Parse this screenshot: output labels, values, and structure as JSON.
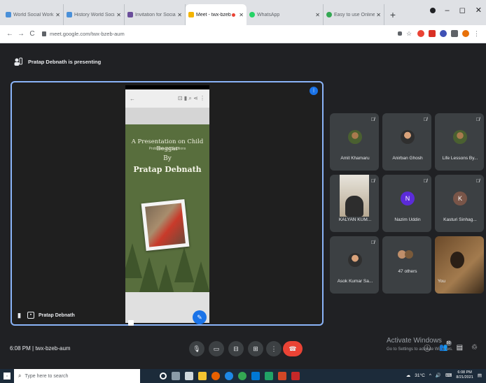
{
  "browser": {
    "tabs": [
      {
        "title": "World Social Work Da",
        "fav": "#4a90d9"
      },
      {
        "title": "History World Social",
        "fav": "#4a90d9"
      },
      {
        "title": "Invitation for Social W",
        "fav": "#6b4e9b"
      },
      {
        "title": "Meet - twx-bzeb",
        "fav": "#f4b400",
        "active": true
      },
      {
        "title": "WhatsApp",
        "fav": "#25d366"
      },
      {
        "title": "Easy to use Online PD",
        "fav": "#34a853"
      }
    ],
    "new_tab": "+",
    "url": "meet.google.com/twx-bzeb-aum",
    "controls": {
      "minimize": "–",
      "maximize": "◻",
      "close": "✕"
    }
  },
  "meet": {
    "presenting_banner": "Pratap Debnath is presenting",
    "stage": {
      "presenter_name": "Pratap Debnath",
      "slide": {
        "title": "A Presentation on Child Beggar",
        "subtitle": "Problems and Solutions",
        "by": "By",
        "name": "Pratap Debnath"
      }
    },
    "participants": [
      {
        "name": "Amit Khamaru",
        "avatar": "photo"
      },
      {
        "name": "Anirban Ghosh",
        "avatar": "photo"
      },
      {
        "name": "Life Lessons By...",
        "avatar": "photo"
      },
      {
        "name": "KALYAN KUM...",
        "avatar": "video"
      },
      {
        "name": "Nazim Uddin",
        "avatar": "letter",
        "letter": "N",
        "color": "#5b2bd9"
      },
      {
        "name": "Kasturi Sinhag...",
        "avatar": "letter",
        "letter": "K",
        "color": "#795548"
      },
      {
        "name": "Asok Kumar Sa...",
        "avatar": "photo"
      },
      {
        "name": "47 others",
        "avatar": "group"
      },
      {
        "name": "You",
        "avatar": "video"
      }
    ],
    "bottom": {
      "time_code": "6:08 PM | twx-bzeb-aum",
      "activate_title": "Activate Windows",
      "activate_sub": "Go to Settings to activate Windows.",
      "people_count": "50"
    }
  },
  "taskbar": {
    "search_placeholder": "Type here to search",
    "temp": "31°C",
    "time": "6:08 PM",
    "date": "8/21/2021"
  }
}
